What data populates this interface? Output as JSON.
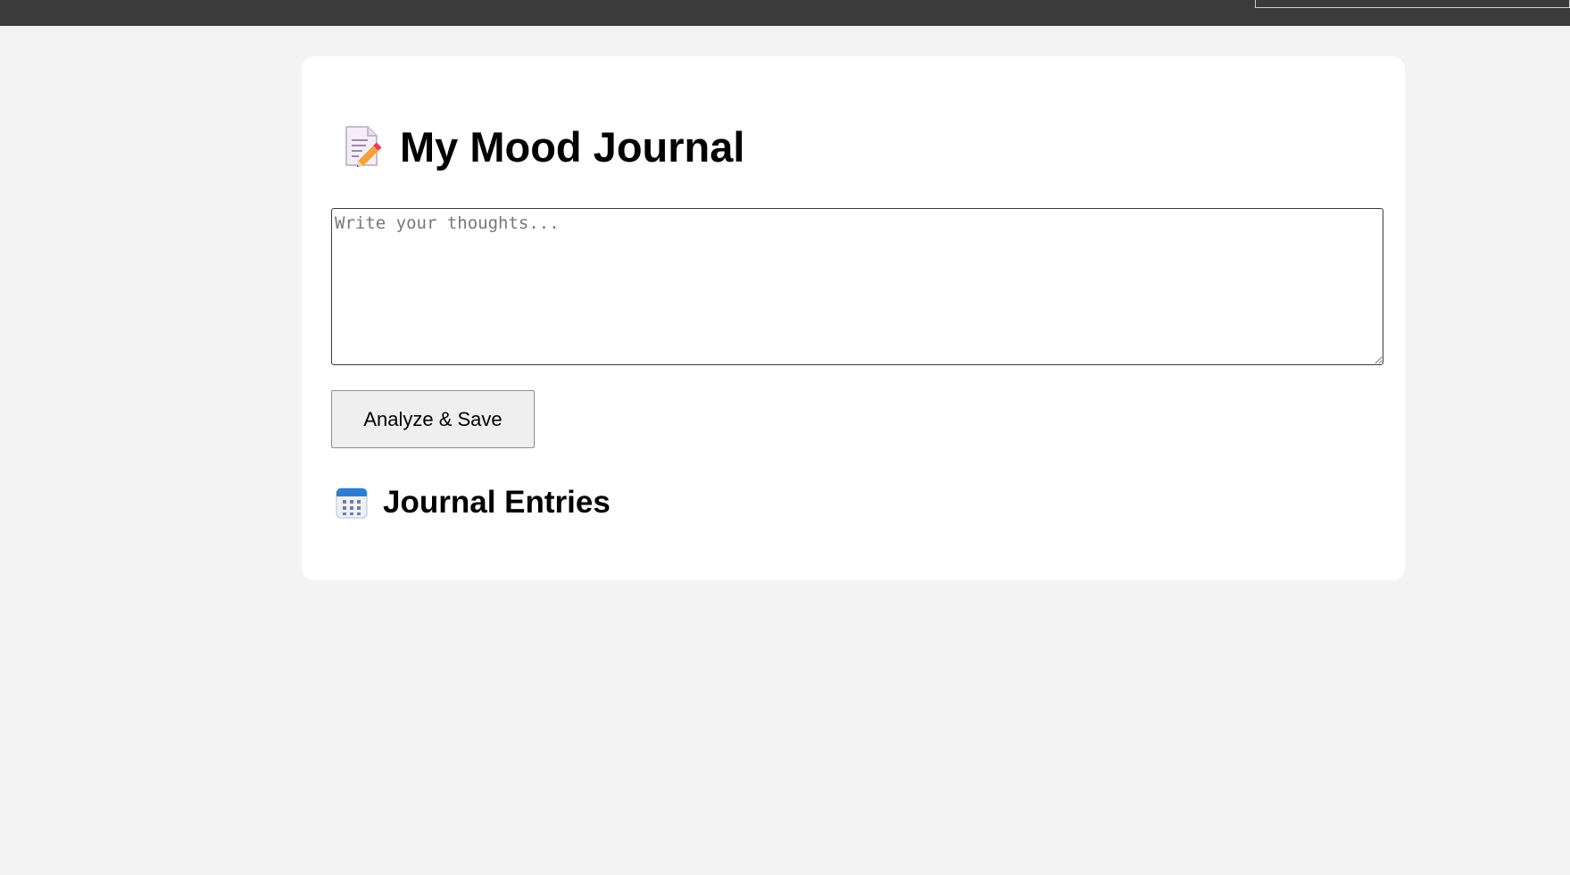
{
  "header": {
    "title": "My Mood Journal",
    "title_icon": "memo-pencil-icon"
  },
  "editor": {
    "value": "",
    "placeholder": "Write your thoughts..."
  },
  "actions": {
    "save_label": "Analyze & Save"
  },
  "entries": {
    "heading": "Journal Entries",
    "heading_icon": "calendar-icon",
    "items": []
  },
  "colors": {
    "page_background": "#f3f3f3",
    "top_bar": "#3b3b3b",
    "card_background": "#ffffff",
    "button_background": "#efefef"
  }
}
